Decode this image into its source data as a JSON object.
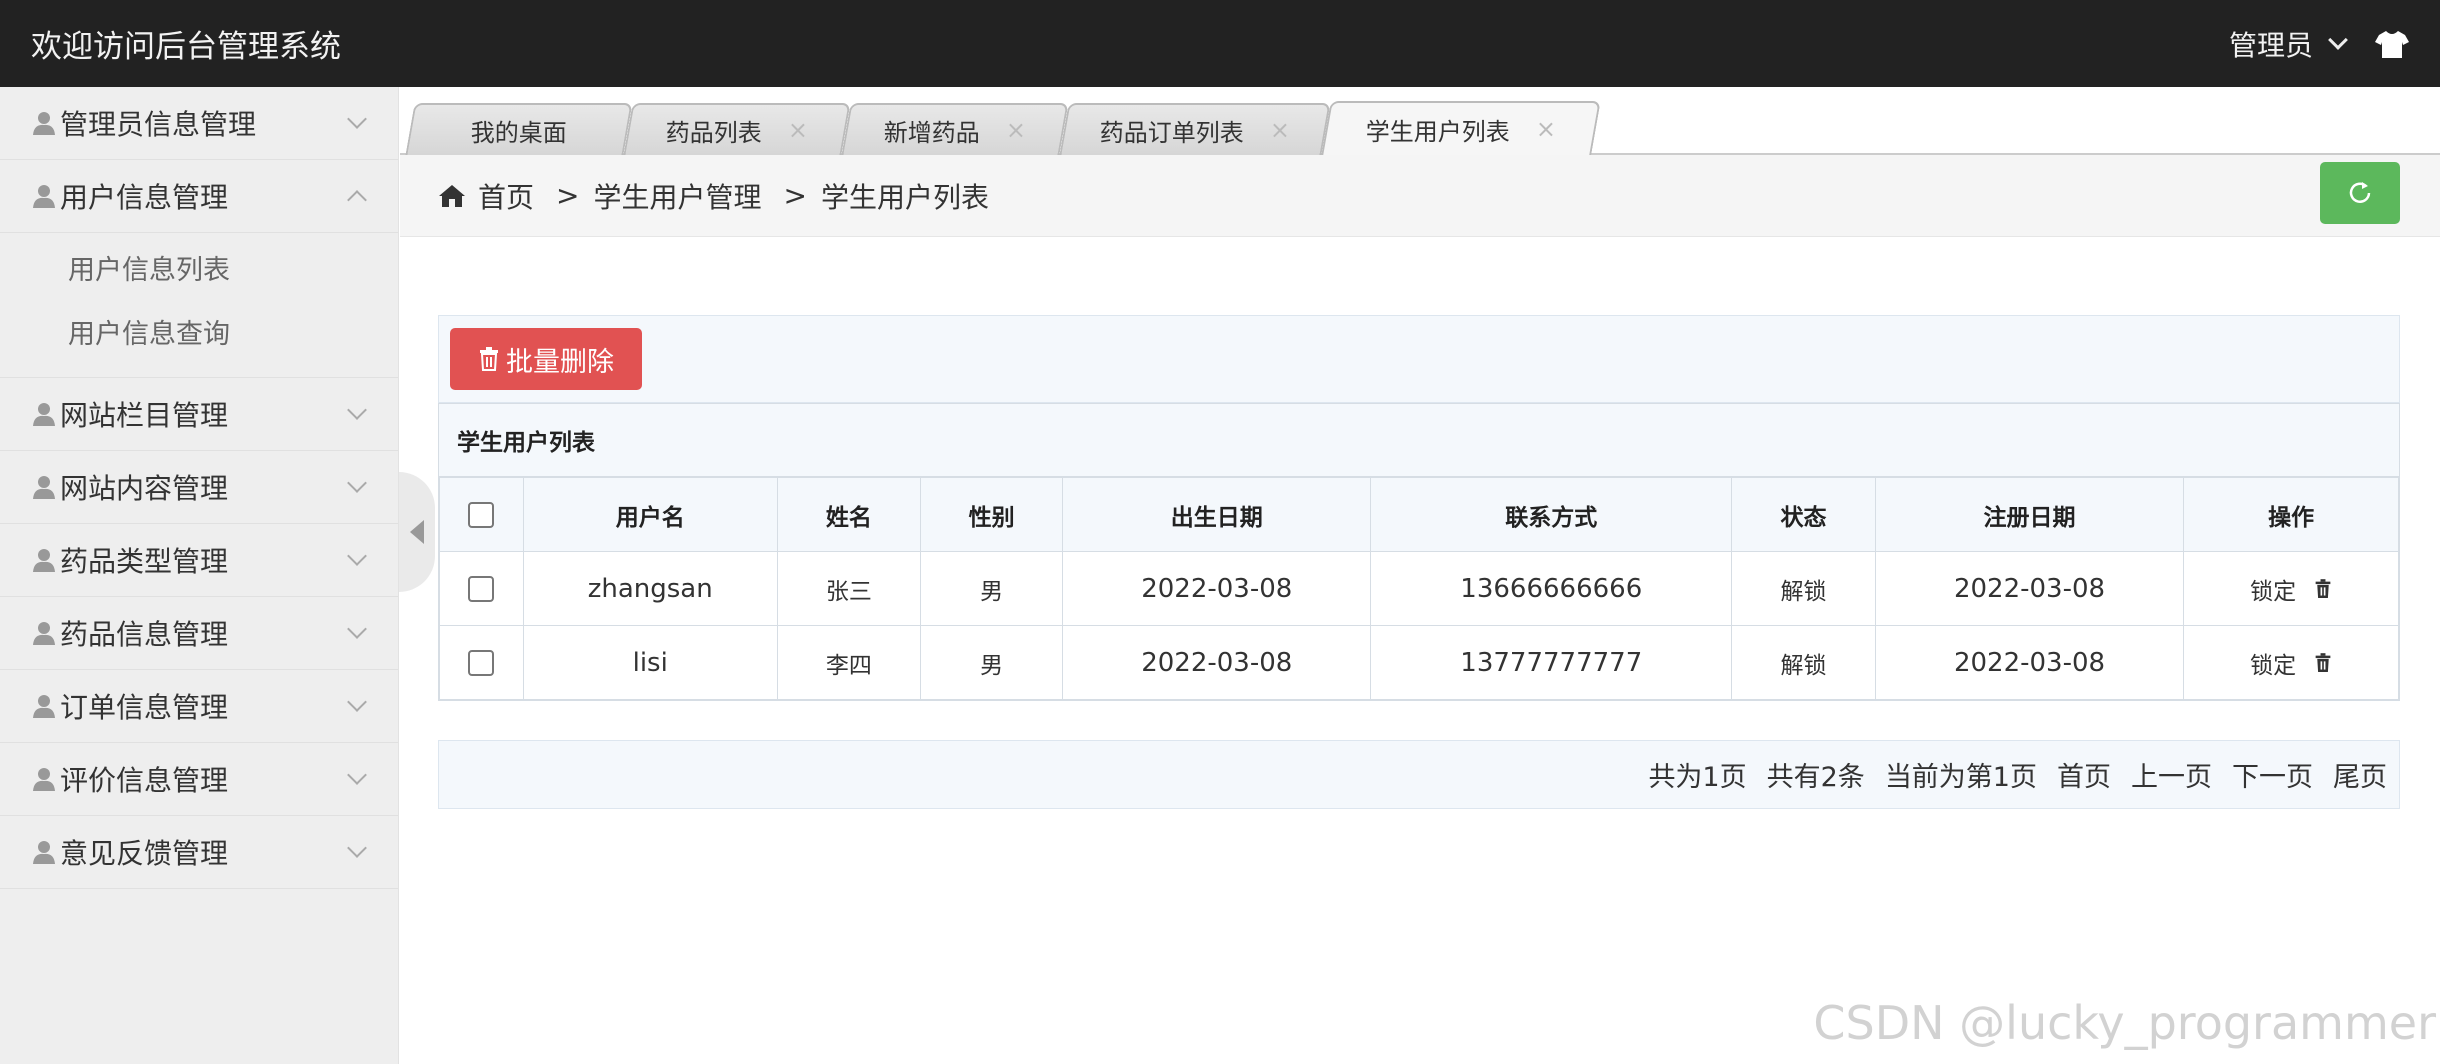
{
  "header": {
    "title": "欢迎访问后台管理系统",
    "user_label": "管理员"
  },
  "sidebar": {
    "items": [
      {
        "label": "管理员信息管理",
        "expanded": false
      },
      {
        "label": "用户信息管理",
        "expanded": true,
        "children": [
          "用户信息列表",
          "用户信息查询"
        ]
      },
      {
        "label": "网站栏目管理",
        "expanded": false
      },
      {
        "label": "网站内容管理",
        "expanded": false
      },
      {
        "label": "药品类型管理",
        "expanded": false
      },
      {
        "label": "药品信息管理",
        "expanded": false
      },
      {
        "label": "订单信息管理",
        "expanded": false
      },
      {
        "label": "评价信息管理",
        "expanded": false
      },
      {
        "label": "意见反馈管理",
        "expanded": false
      }
    ]
  },
  "tabs": [
    {
      "label": "我的桌面",
      "closable": false,
      "active": false
    },
    {
      "label": "药品列表",
      "closable": true,
      "active": false
    },
    {
      "label": "新增药品",
      "closable": true,
      "active": false
    },
    {
      "label": "药品订单列表",
      "closable": true,
      "active": false
    },
    {
      "label": "学生用户列表",
      "closable": true,
      "active": true
    }
  ],
  "tab_close_glyph": "×",
  "breadcrumb": {
    "home": "首页",
    "sep": ">",
    "level1": "学生用户管理",
    "level2": "学生用户列表"
  },
  "toolbar": {
    "batch_delete_label": "批量删除"
  },
  "table": {
    "title": "学生用户列表",
    "headers": [
      "用户名",
      "姓名",
      "性别",
      "出生日期",
      "联系方式",
      "状态",
      "注册日期",
      "操作"
    ],
    "rows": [
      {
        "username": "zhangsan",
        "name": "张三",
        "gender": "男",
        "birth": "2022-03-08",
        "phone": "13666666666",
        "status": "解锁",
        "reg_date": "2022-03-08",
        "lock_label": "锁定"
      },
      {
        "username": "lisi",
        "name": "李四",
        "gender": "男",
        "birth": "2022-03-08",
        "phone": "13777777777",
        "status": "解锁",
        "reg_date": "2022-03-08",
        "lock_label": "锁定"
      }
    ]
  },
  "pager": {
    "total_pages": "共为1页",
    "total_items": "共有2条",
    "current": "当前为第1页",
    "first": "首页",
    "prev": "上一页",
    "next": "下一页",
    "last": "尾页"
  },
  "watermark": "CSDN @lucky_programmer",
  "colors": {
    "header_bg": "#222222",
    "danger": "#e15252",
    "success": "#5cb85c"
  }
}
